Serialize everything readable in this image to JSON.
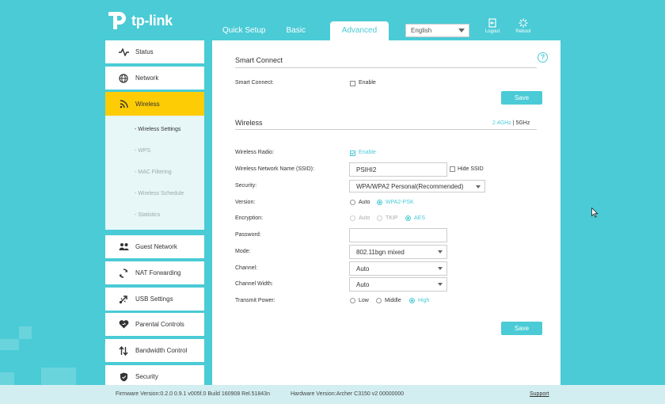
{
  "brand": "tp-link",
  "header": {
    "tabs": [
      "Quick Setup",
      "Basic",
      "Advanced"
    ],
    "active_tab": "Advanced",
    "language": "English",
    "logout_label": "Logout",
    "reboot_label": "Reboot"
  },
  "sidebar": {
    "items": [
      {
        "label": "Status",
        "icon": "pulse-icon"
      },
      {
        "label": "Network",
        "icon": "globe-icon"
      },
      {
        "label": "Wireless",
        "icon": "wifi-icon"
      },
      {
        "label": "Guest Network",
        "icon": "guests-icon"
      },
      {
        "label": "NAT Forwarding",
        "icon": "nat-icon"
      },
      {
        "label": "USB Settings",
        "icon": "usb-icon"
      },
      {
        "label": "Parental Controls",
        "icon": "heart-icon"
      },
      {
        "label": "Bandwidth Control",
        "icon": "updown-arrows-icon"
      },
      {
        "label": "Security",
        "icon": "shield-icon"
      }
    ],
    "wireless_sub": [
      "- Wireless Settings",
      "- WPS",
      "- MAC Filtering",
      "- Wireless Schedule",
      "- Statistics"
    ]
  },
  "smart_connect": {
    "title": "Smart Connect",
    "label": "Smart Connect:",
    "enable_label": "Enable",
    "enabled": false,
    "save_label": "Save"
  },
  "wireless": {
    "title": "Wireless",
    "band_24": "2.4GHz",
    "band_sep": "|",
    "band_5": "5GHz",
    "radio_label": "Wireless Radio:",
    "radio_enable": "Enable",
    "radio_enabled": true,
    "ssid_label": "Wireless Network Name (SSID):",
    "ssid_value": "PSIHI2",
    "hide_ssid": "Hide SSID",
    "security_label": "Security:",
    "security_value": "WPA/WPA2 Personal(Recommended)",
    "version_label": "Version:",
    "version_options": [
      "Auto",
      "WPA2-PSK"
    ],
    "version_selected": "WPA2-PSK",
    "encryption_label": "Encryption:",
    "encryption_options": [
      "Auto",
      "TKIP",
      "AES"
    ],
    "encryption_selected": "AES",
    "password_label": "Password:",
    "password_value": "",
    "mode_label": "Mode:",
    "mode_value": "802.11bgn mixed",
    "channel_label": "Channel:",
    "channel_value": "Auto",
    "width_label": "Channel Width:",
    "width_value": "Auto",
    "power_label": "Transmit Power:",
    "power_options": [
      "Low",
      "Middle",
      "High"
    ],
    "power_selected": "High",
    "save_label": "Save"
  },
  "footer": {
    "firmware": "Firmware Version:0.2.0 0.9.1 v005f.0 Build 160908 Rel.51843n",
    "hardware": "Hardware Version:Archer C3150 v2 00000000",
    "support": "Support"
  },
  "colors": {
    "accent": "#4acbd6",
    "active_menu": "#fecc04",
    "submenu_bg": "#e7f6f7"
  }
}
